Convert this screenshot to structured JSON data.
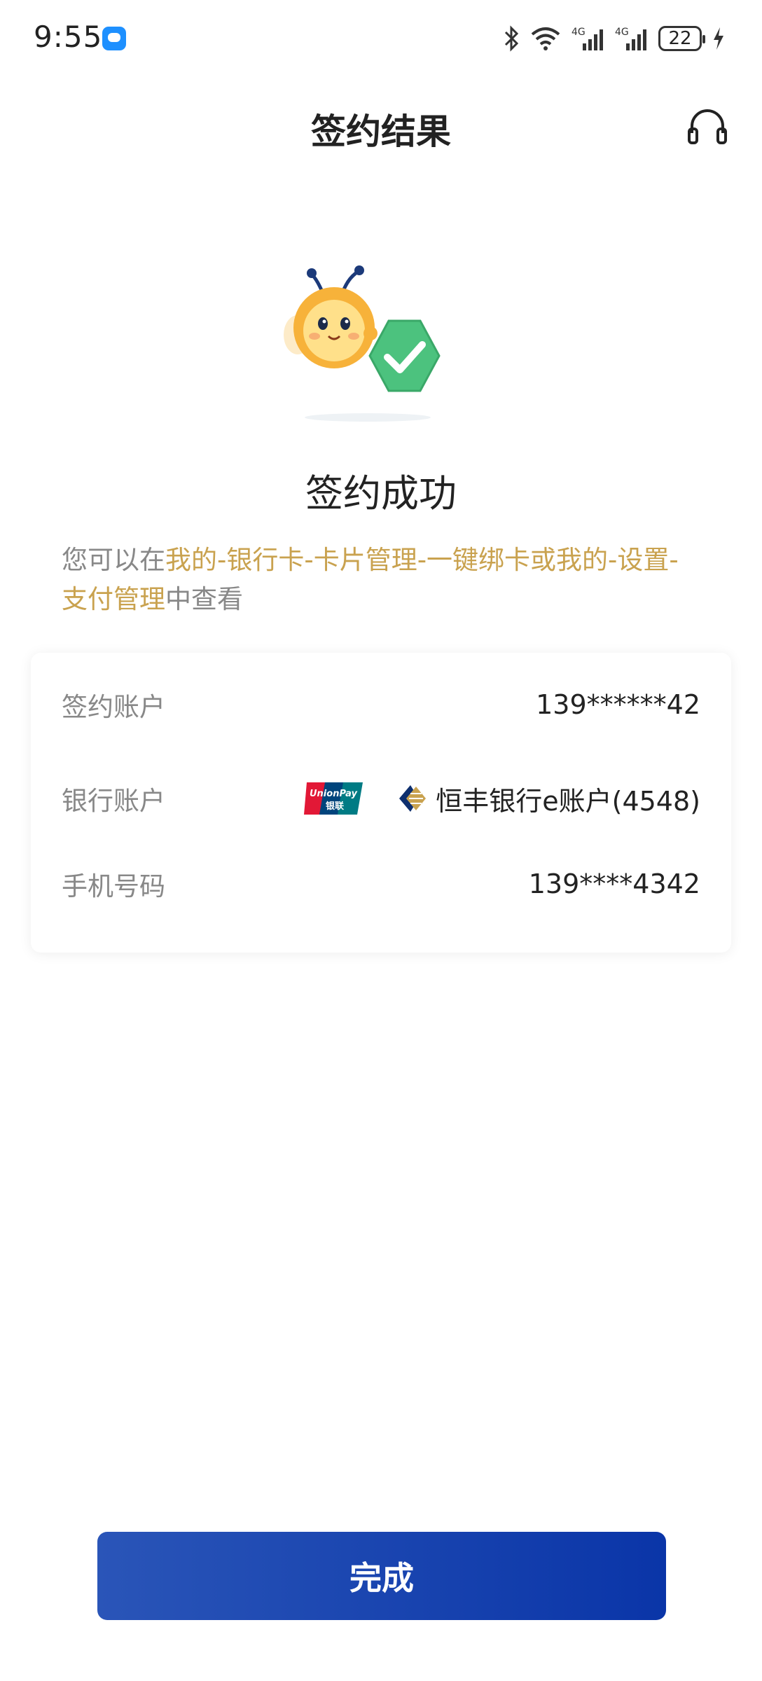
{
  "status_bar": {
    "time": "9:55",
    "network_1": "4G",
    "network_2": "4G",
    "battery": "22"
  },
  "header": {
    "title": "签约结果",
    "customer_service_icon": "headset-icon"
  },
  "result": {
    "title": "签约成功",
    "tip_prefix": "您可以在",
    "tip_link": "我的-银行卡-卡片管理-一键绑卡或我的-设置-支付管理",
    "tip_suffix": "中查看"
  },
  "details": {
    "rows": [
      {
        "label": "签约账户",
        "value": "139******42"
      },
      {
        "label": "银行账户",
        "value": "恒丰银行e账户(4548)",
        "unionpay_text": "UnionPay",
        "unionpay_cn": "银联"
      },
      {
        "label": "手机号码",
        "value": "139****4342"
      }
    ]
  },
  "actions": {
    "done_label": "完成"
  },
  "colors": {
    "accent_link": "#c9a24f",
    "primary_button": "#1a45b0",
    "success_green": "#4cc27e"
  }
}
